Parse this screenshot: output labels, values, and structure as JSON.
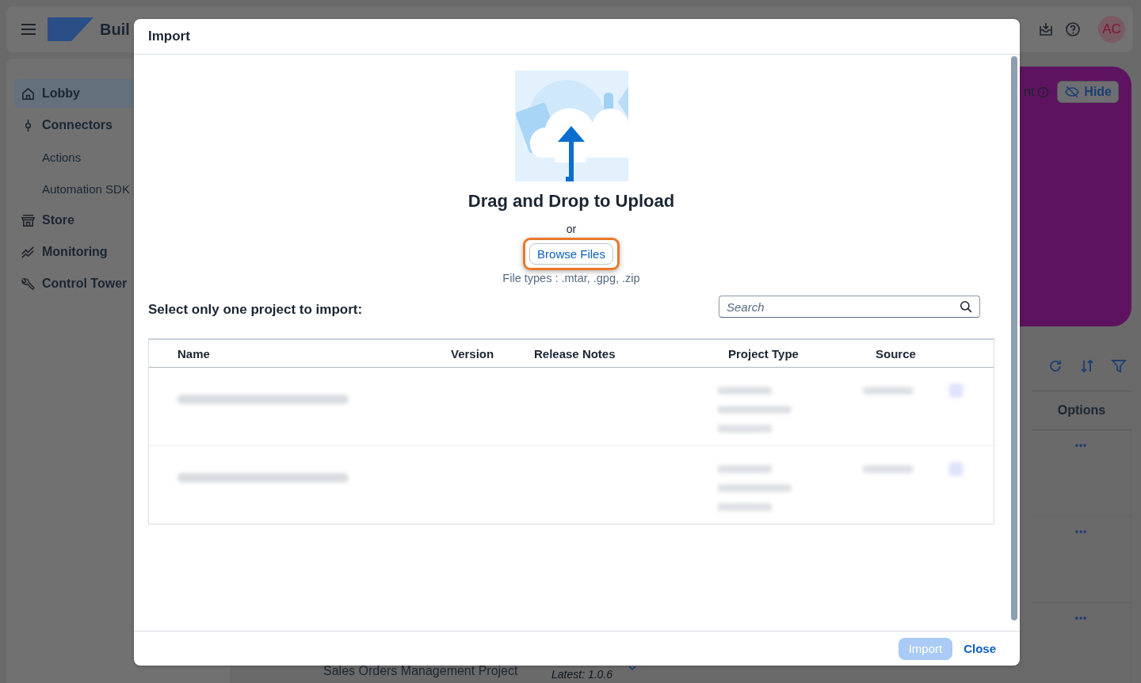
{
  "app": {
    "title": "Buil",
    "avatar": "AC",
    "sidebar": [
      {
        "label": "Lobby",
        "kind": "main",
        "selected": true
      },
      {
        "label": "Connectors",
        "kind": "main",
        "selected": false
      },
      {
        "label": "Actions",
        "kind": "sub",
        "selected": false
      },
      {
        "label": "Automation SDK",
        "kind": "sub",
        "selected": false
      },
      {
        "label": "Store",
        "kind": "main",
        "selected": false
      },
      {
        "label": "Monitoring",
        "kind": "main",
        "selected": false
      },
      {
        "label": "Control Tower",
        "kind": "main",
        "selected": false
      }
    ],
    "banner": {
      "text": "nt",
      "hide_button": "Hide"
    },
    "table": {
      "options_header": "Options",
      "row_count_dots": [
        "•••",
        "•••",
        "•••"
      ],
      "bottom_row": {
        "name": "Sales Orders Management Project",
        "version": "Latest: 1.0.6"
      }
    }
  },
  "dialog": {
    "title": "Import",
    "upload": {
      "heading": "Drag and Drop to Upload",
      "or": "or",
      "browse_button": "Browse Files",
      "highlighted": true,
      "file_types": "File types : .mtar, .gpg, .zip"
    },
    "select_label": "Select only one project to import:",
    "search": {
      "placeholder": "Search"
    },
    "table": {
      "columns": [
        "Name",
        "Version",
        "Release Notes",
        "Project Type",
        "Source"
      ],
      "rows": [
        {
          "blurred": true
        },
        {
          "blurred": true
        }
      ]
    },
    "footer": {
      "import_button": {
        "label": "Import",
        "disabled": true
      },
      "close_button": "Close"
    }
  }
}
